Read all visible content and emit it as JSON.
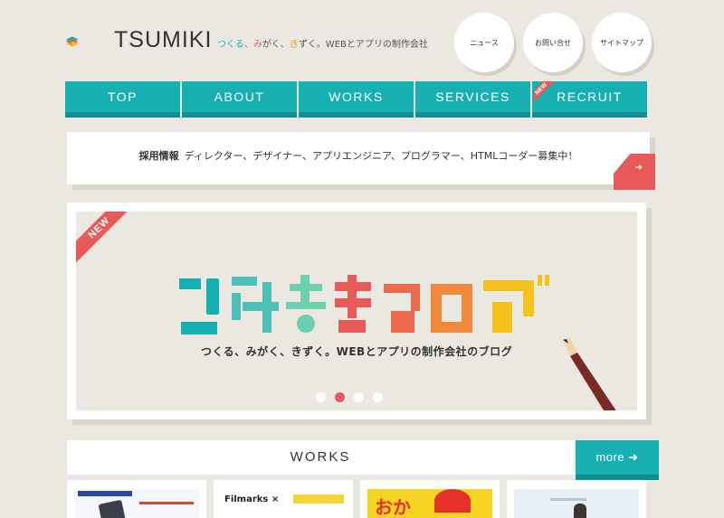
{
  "header": {
    "logo_text": "TSUMIKI",
    "tagline": {
      "part1": "つくる、",
      "part2": "み",
      "part3": "がく、",
      "part4": "き",
      "part5": "ずく。WEBとアプリの制作会社"
    },
    "circles": [
      "ニュース",
      "お問い合せ",
      "サイトマップ"
    ]
  },
  "nav": {
    "items": [
      "TOP",
      "ABOUT",
      "WORKS",
      "SERVICES",
      "RECRUIT"
    ],
    "new_label": "NEW"
  },
  "recruit": {
    "label": "採用情報",
    "text": "ディレクター、デザイナー、アプリエンジニア、プログラマー、HTMLコーダー募集中！"
  },
  "slider": {
    "ribbon": "NEW",
    "subtitle": "つくる、みがく、きずく。WEBとアプリの制作会社のブログ",
    "dots": 4,
    "active_dot": 2
  },
  "works": {
    "title": "WORKS",
    "more_label": "more ➜"
  },
  "thumbs": {
    "t2_text": "Filmarks ×",
    "t3_text": "おか"
  },
  "colors": {
    "teal": "#16b0b2",
    "red": "#e85a5a",
    "orange": "#f39c12",
    "yellow": "#f5c21b"
  }
}
